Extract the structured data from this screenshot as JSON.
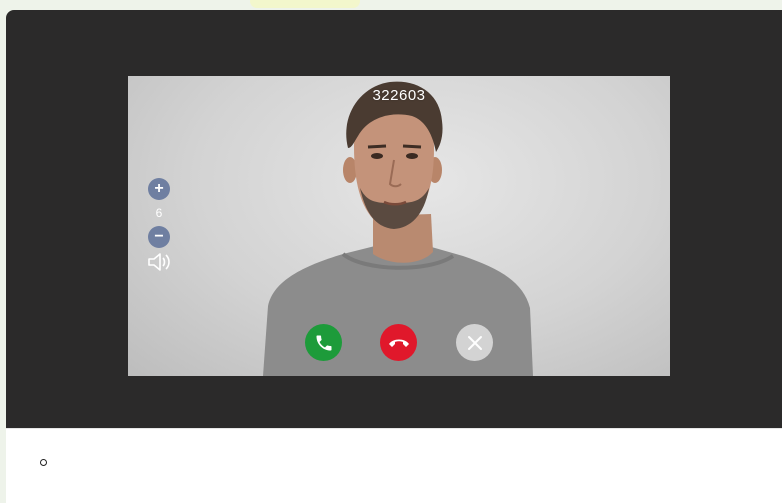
{
  "call": {
    "caller_id": "322603"
  },
  "volume": {
    "increase_symbol": "+",
    "level": "6",
    "decrease_symbol": "−"
  },
  "actions": {
    "answer_icon": "phone-answer-icon",
    "hangup_icon": "phone-hangup-icon",
    "dismiss_icon": "close-icon"
  },
  "colors": {
    "answer": "#1d9b3a",
    "hangup": "#e0182b",
    "volume_button": "#6f7fa1",
    "device_frame": "#2b2a2a"
  }
}
